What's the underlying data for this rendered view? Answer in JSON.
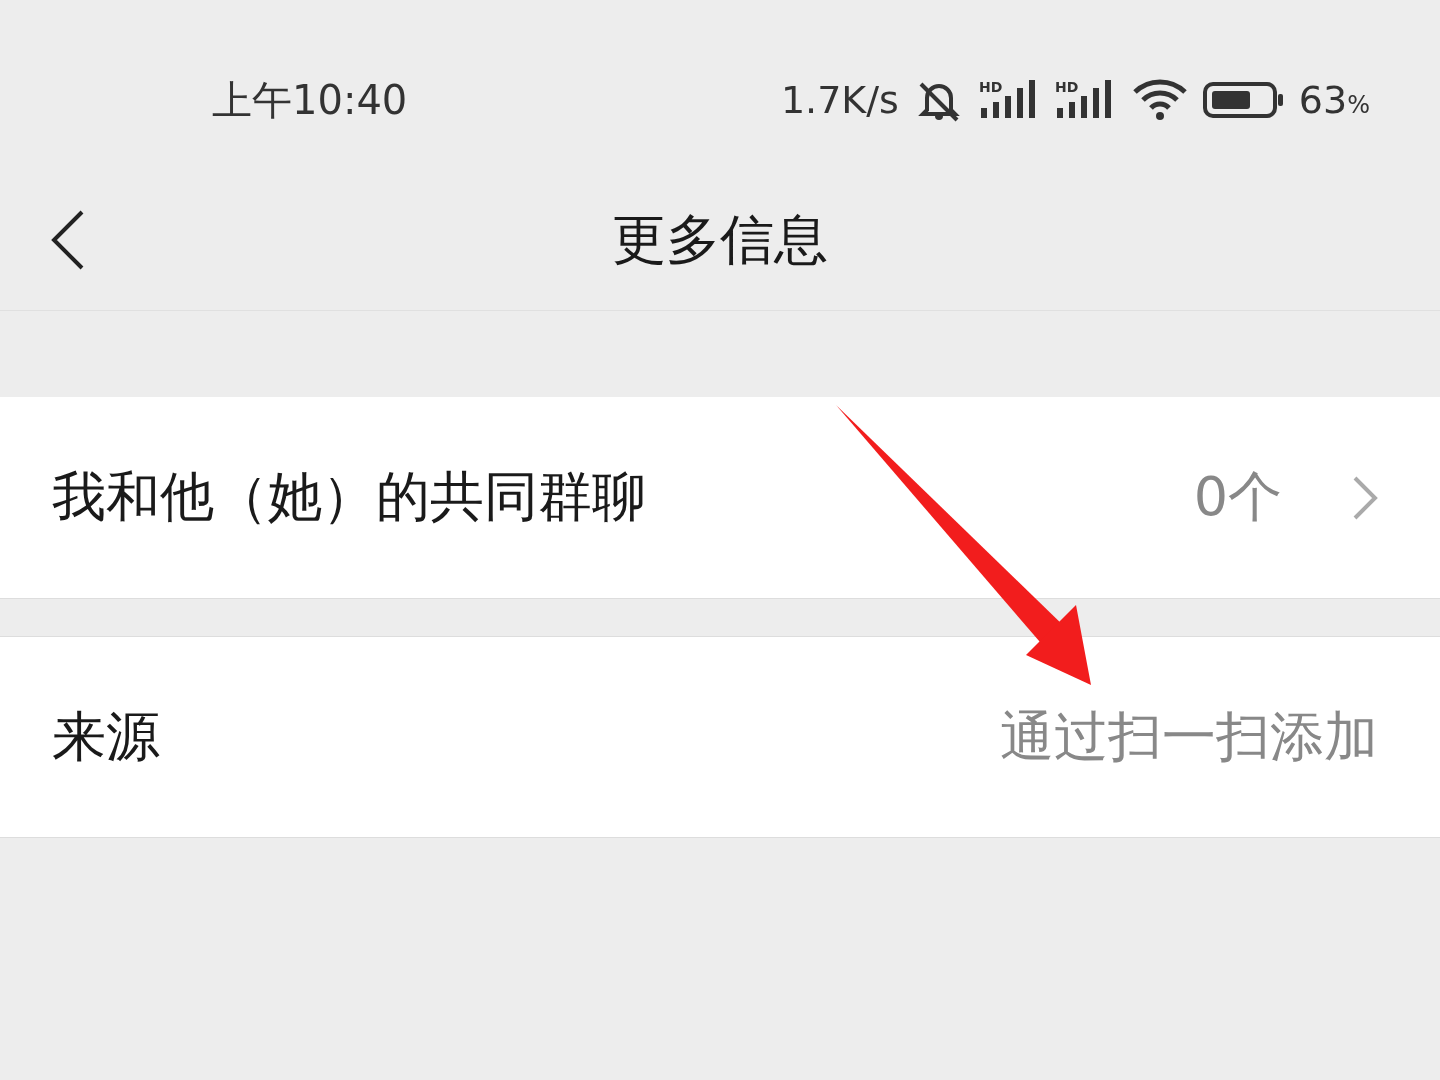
{
  "status_bar": {
    "time": "上午10:40",
    "net_speed": "1.7K/s",
    "signals": [
      {
        "label": "HD"
      },
      {
        "label": "HD"
      }
    ],
    "battery": "63%"
  },
  "nav_bar": {
    "title": "更多信息"
  },
  "rows": [
    {
      "kind": "link",
      "label": "我和他（她）的共同群聊",
      "value": "0个"
    },
    {
      "kind": "info",
      "label": "来源",
      "value": "通过扫一扫添加"
    }
  ]
}
